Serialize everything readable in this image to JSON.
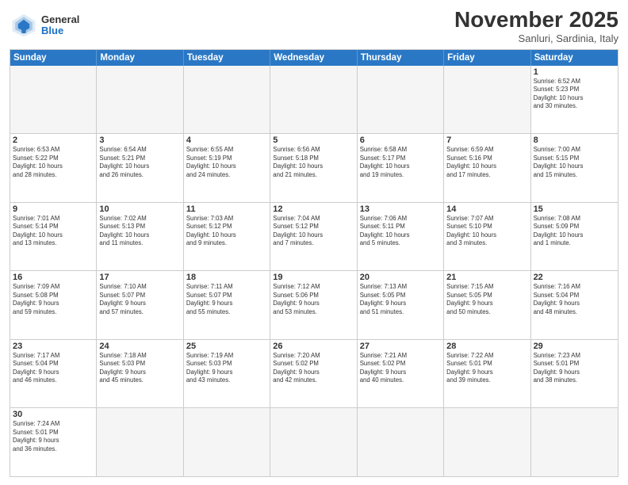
{
  "header": {
    "logo_general": "General",
    "logo_blue": "Blue",
    "month": "November 2025",
    "location": "Sanluri, Sardinia, Italy"
  },
  "days_of_week": [
    "Sunday",
    "Monday",
    "Tuesday",
    "Wednesday",
    "Thursday",
    "Friday",
    "Saturday"
  ],
  "weeks": [
    [
      {
        "day": "",
        "info": ""
      },
      {
        "day": "",
        "info": ""
      },
      {
        "day": "",
        "info": ""
      },
      {
        "day": "",
        "info": ""
      },
      {
        "day": "",
        "info": ""
      },
      {
        "day": "",
        "info": ""
      },
      {
        "day": "1",
        "info": "Sunrise: 6:52 AM\nSunset: 5:23 PM\nDaylight: 10 hours\nand 30 minutes."
      }
    ],
    [
      {
        "day": "2",
        "info": "Sunrise: 6:53 AM\nSunset: 5:22 PM\nDaylight: 10 hours\nand 28 minutes."
      },
      {
        "day": "3",
        "info": "Sunrise: 6:54 AM\nSunset: 5:21 PM\nDaylight: 10 hours\nand 26 minutes."
      },
      {
        "day": "4",
        "info": "Sunrise: 6:55 AM\nSunset: 5:19 PM\nDaylight: 10 hours\nand 24 minutes."
      },
      {
        "day": "5",
        "info": "Sunrise: 6:56 AM\nSunset: 5:18 PM\nDaylight: 10 hours\nand 21 minutes."
      },
      {
        "day": "6",
        "info": "Sunrise: 6:58 AM\nSunset: 5:17 PM\nDaylight: 10 hours\nand 19 minutes."
      },
      {
        "day": "7",
        "info": "Sunrise: 6:59 AM\nSunset: 5:16 PM\nDaylight: 10 hours\nand 17 minutes."
      },
      {
        "day": "8",
        "info": "Sunrise: 7:00 AM\nSunset: 5:15 PM\nDaylight: 10 hours\nand 15 minutes."
      }
    ],
    [
      {
        "day": "9",
        "info": "Sunrise: 7:01 AM\nSunset: 5:14 PM\nDaylight: 10 hours\nand 13 minutes."
      },
      {
        "day": "10",
        "info": "Sunrise: 7:02 AM\nSunset: 5:13 PM\nDaylight: 10 hours\nand 11 minutes."
      },
      {
        "day": "11",
        "info": "Sunrise: 7:03 AM\nSunset: 5:12 PM\nDaylight: 10 hours\nand 9 minutes."
      },
      {
        "day": "12",
        "info": "Sunrise: 7:04 AM\nSunset: 5:12 PM\nDaylight: 10 hours\nand 7 minutes."
      },
      {
        "day": "13",
        "info": "Sunrise: 7:06 AM\nSunset: 5:11 PM\nDaylight: 10 hours\nand 5 minutes."
      },
      {
        "day": "14",
        "info": "Sunrise: 7:07 AM\nSunset: 5:10 PM\nDaylight: 10 hours\nand 3 minutes."
      },
      {
        "day": "15",
        "info": "Sunrise: 7:08 AM\nSunset: 5:09 PM\nDaylight: 10 hours\nand 1 minute."
      }
    ],
    [
      {
        "day": "16",
        "info": "Sunrise: 7:09 AM\nSunset: 5:08 PM\nDaylight: 9 hours\nand 59 minutes."
      },
      {
        "day": "17",
        "info": "Sunrise: 7:10 AM\nSunset: 5:07 PM\nDaylight: 9 hours\nand 57 minutes."
      },
      {
        "day": "18",
        "info": "Sunrise: 7:11 AM\nSunset: 5:07 PM\nDaylight: 9 hours\nand 55 minutes."
      },
      {
        "day": "19",
        "info": "Sunrise: 7:12 AM\nSunset: 5:06 PM\nDaylight: 9 hours\nand 53 minutes."
      },
      {
        "day": "20",
        "info": "Sunrise: 7:13 AM\nSunset: 5:05 PM\nDaylight: 9 hours\nand 51 minutes."
      },
      {
        "day": "21",
        "info": "Sunrise: 7:15 AM\nSunset: 5:05 PM\nDaylight: 9 hours\nand 50 minutes."
      },
      {
        "day": "22",
        "info": "Sunrise: 7:16 AM\nSunset: 5:04 PM\nDaylight: 9 hours\nand 48 minutes."
      }
    ],
    [
      {
        "day": "23",
        "info": "Sunrise: 7:17 AM\nSunset: 5:04 PM\nDaylight: 9 hours\nand 46 minutes."
      },
      {
        "day": "24",
        "info": "Sunrise: 7:18 AM\nSunset: 5:03 PM\nDaylight: 9 hours\nand 45 minutes."
      },
      {
        "day": "25",
        "info": "Sunrise: 7:19 AM\nSunset: 5:03 PM\nDaylight: 9 hours\nand 43 minutes."
      },
      {
        "day": "26",
        "info": "Sunrise: 7:20 AM\nSunset: 5:02 PM\nDaylight: 9 hours\nand 42 minutes."
      },
      {
        "day": "27",
        "info": "Sunrise: 7:21 AM\nSunset: 5:02 PM\nDaylight: 9 hours\nand 40 minutes."
      },
      {
        "day": "28",
        "info": "Sunrise: 7:22 AM\nSunset: 5:01 PM\nDaylight: 9 hours\nand 39 minutes."
      },
      {
        "day": "29",
        "info": "Sunrise: 7:23 AM\nSunset: 5:01 PM\nDaylight: 9 hours\nand 38 minutes."
      }
    ],
    [
      {
        "day": "30",
        "info": "Sunrise: 7:24 AM\nSunset: 5:01 PM\nDaylight: 9 hours\nand 36 minutes."
      },
      {
        "day": "",
        "info": ""
      },
      {
        "day": "",
        "info": ""
      },
      {
        "day": "",
        "info": ""
      },
      {
        "day": "",
        "info": ""
      },
      {
        "day": "",
        "info": ""
      },
      {
        "day": "",
        "info": ""
      }
    ]
  ]
}
